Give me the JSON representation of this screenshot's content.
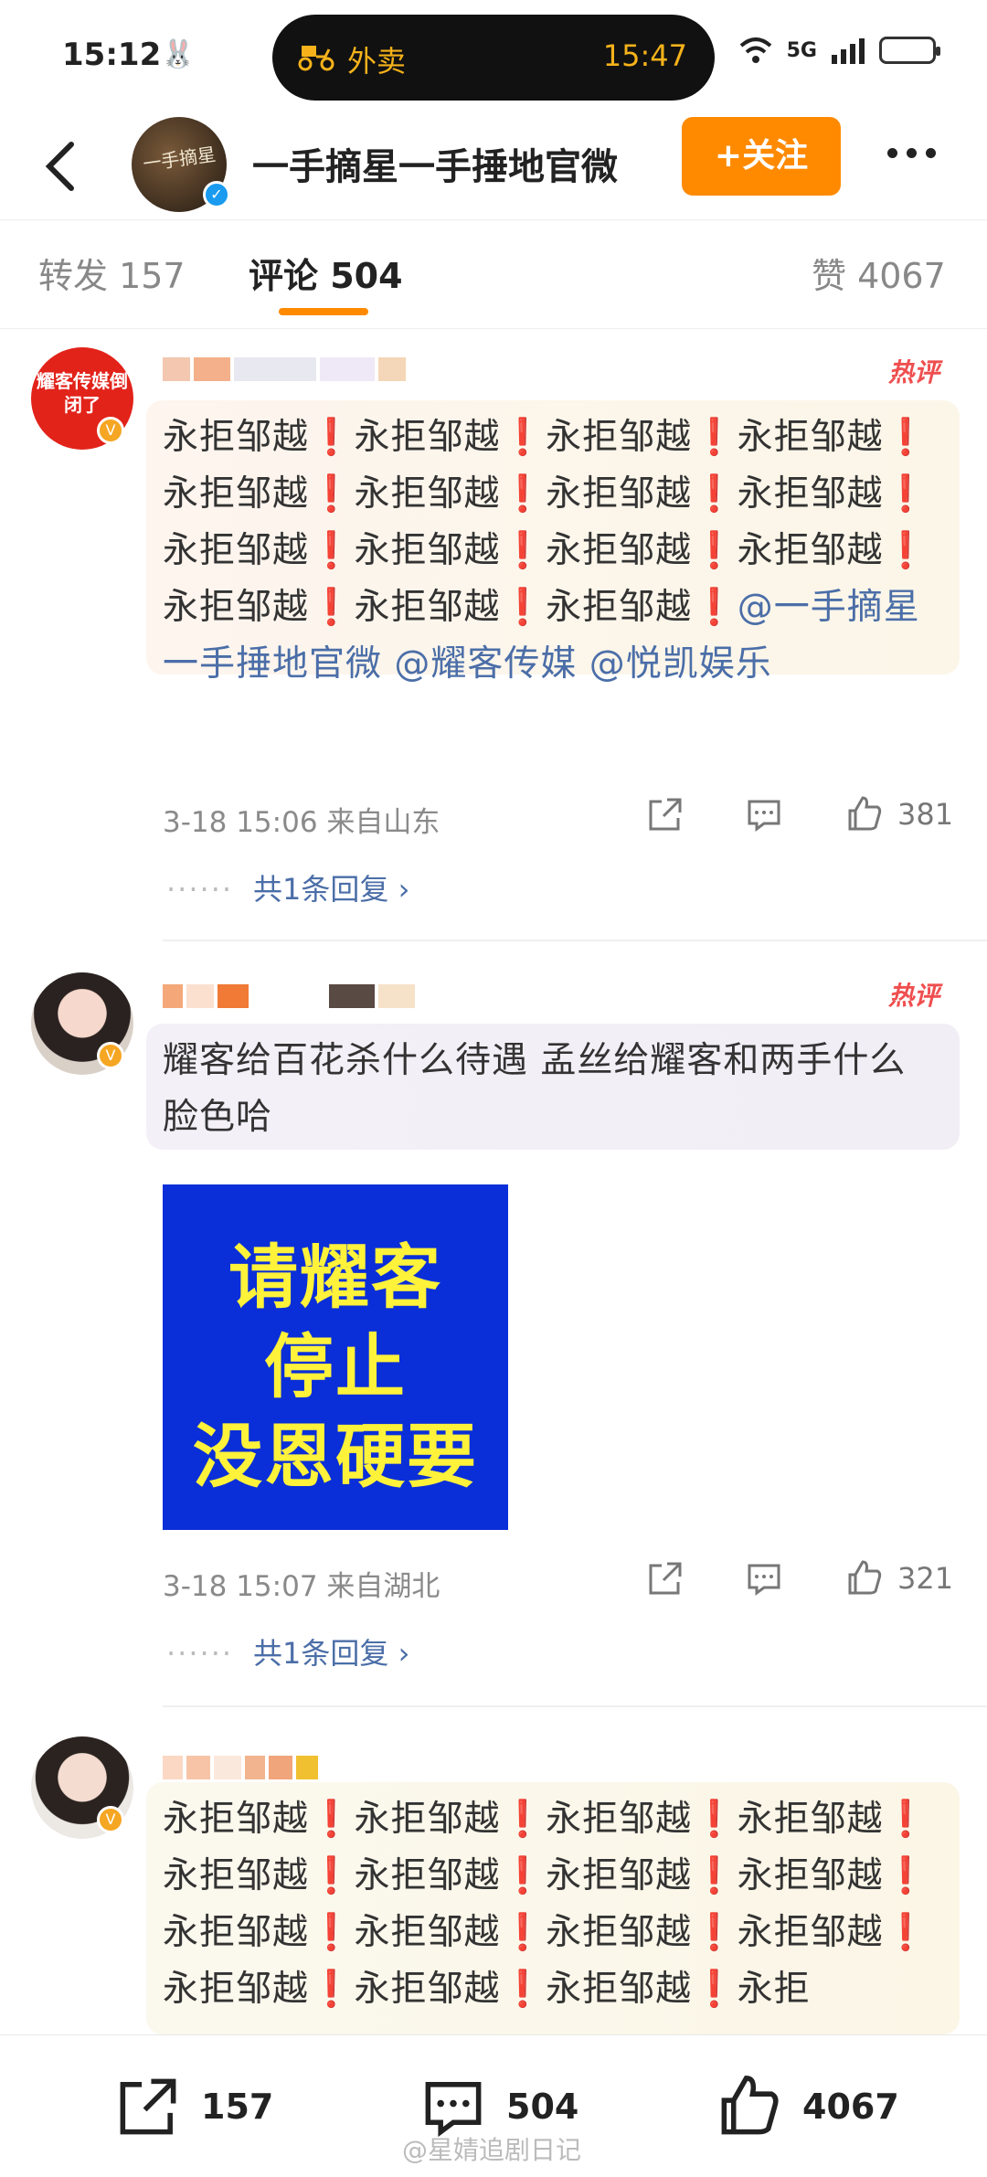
{
  "status_bar": {
    "time": "15:12",
    "island_label": "外卖",
    "island_time": "15:47",
    "network": "5G"
  },
  "header": {
    "title": "一手摘星一手捶地官微",
    "follow_label": "+关注"
  },
  "tabs": [
    {
      "label": "转发 157"
    },
    {
      "label": "评论 504"
    },
    {
      "label": "赞 4067"
    }
  ],
  "comments": [
    {
      "avatar_text": "耀客传媒倒闭了",
      "hot_tag": "热评",
      "body_plain": "永拒邹越❗永拒邹越❗永拒邹越❗永拒邹越❗永拒邹越❗永拒邹越❗永拒邹越❗永拒邹越❗永拒邹越❗永拒邹越❗永拒邹越❗永拒邹越❗永拒邹越❗永拒邹越❗永拒邹越❗",
      "mentions": "@一手摘星一手捶地官微 @耀客传媒 @悦凯娱乐",
      "meta": "3-18 15:06  来自山东",
      "likes": "381",
      "replies": "共1条回复 ›"
    },
    {
      "hot_tag": "热评",
      "body_plain": "耀客给百花杀什么待遇 孟丝给耀客和两手什么脸色哈",
      "image_lines": [
        "请耀客",
        "停止",
        "没恩硬要"
      ],
      "meta": "3-18 15:07  来自湖北",
      "likes": "321",
      "replies": "共1条回复 ›"
    },
    {
      "body_plain": "永拒邹越❗永拒邹越❗永拒邹越❗永拒邹越❗永拒邹越❗永拒邹越❗永拒邹越❗永拒邹越❗永拒邹越❗永拒邹越❗永拒邹越❗永拒邹越❗永拒邹越❗永拒邹越❗永拒邹越❗永拒"
    }
  ],
  "bottom_bar": {
    "repost_count": "157",
    "comment_count": "504",
    "like_count": "4067",
    "watermark": "@星婧追剧日记"
  },
  "colors": {
    "accent": "#ff8a00",
    "link": "#4b6ea8",
    "hot": "#ef4f4f",
    "image_bg": "#0a2fd8",
    "image_text": "#fff23a"
  }
}
